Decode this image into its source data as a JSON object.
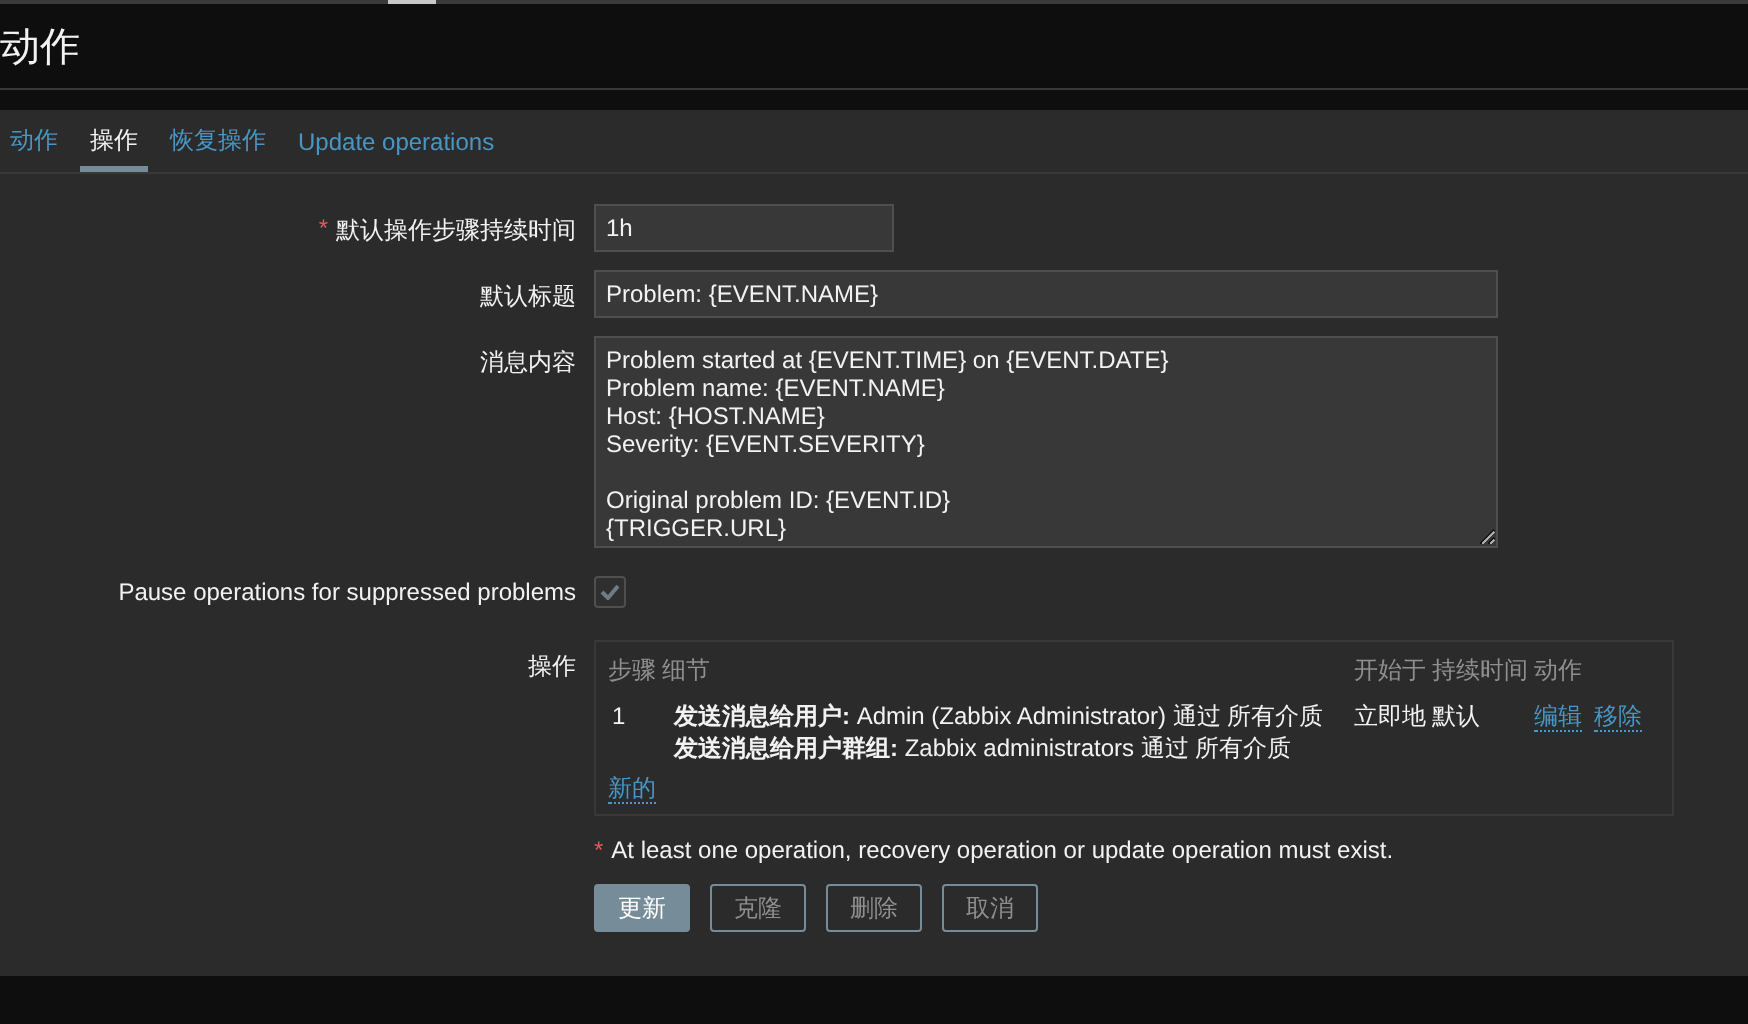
{
  "header": {
    "title": "动作"
  },
  "tabs": [
    {
      "label": "动作",
      "selected": false
    },
    {
      "label": "操作",
      "selected": true
    },
    {
      "label": "恢复操作",
      "selected": false
    },
    {
      "label": "Update operations",
      "selected": false
    }
  ],
  "fields": [
    {
      "kind": "duration",
      "label": "默认操作步骤持续时间",
      "required_mark": "*",
      "value": "1h"
    },
    {
      "kind": "text",
      "label": "默认标题",
      "value": "Problem: {EVENT.NAME}"
    },
    {
      "kind": "textarea",
      "label": "消息内容",
      "value": "Problem started at {EVENT.TIME} on {EVENT.DATE}\nProblem name: {EVENT.NAME}\nHost: {HOST.NAME}\nSeverity: {EVENT.SEVERITY}\n\nOriginal problem ID: {EVENT.ID}\n{TRIGGER.URL}"
    },
    {
      "kind": "checkbox",
      "label": "Pause operations for suppressed problems",
      "checked": true,
      "disabled": true
    }
  ],
  "operations": {
    "label": "操作",
    "columns": [
      "步骤",
      "细节",
      "开始于",
      "持续时间",
      "动作"
    ],
    "rows": [
      {
        "step": "1",
        "details": [
          "**发送消息给用户:** Admin (Zabbix Administrator) 通过 所有介质",
          "**发送消息给用户群组:** Zabbix administrators 通过 所有介质"
        ],
        "start": "立即地",
        "duration": "默认",
        "actions": [
          "编辑",
          "移除"
        ]
      }
    ],
    "new_link": "新的"
  },
  "note": {
    "required_mark": "*",
    "text": "At least one operation, recovery operation or update operation must exist."
  },
  "buttons": [
    {
      "label": "更新",
      "primary": true
    },
    {
      "label": "克隆",
      "primary": false
    },
    {
      "label": "删除",
      "primary": false
    },
    {
      "label": "取消",
      "primary": false
    }
  ]
}
